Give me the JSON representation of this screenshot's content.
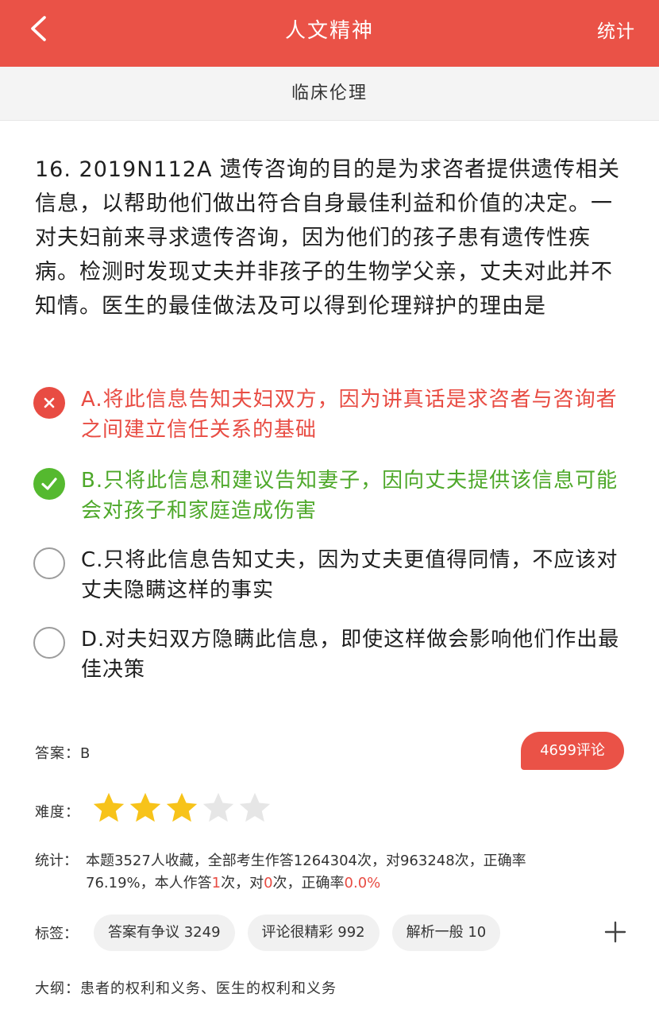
{
  "header": {
    "title": "人文精神",
    "right_link": "统计"
  },
  "subheader": {
    "category": "临床伦理"
  },
  "question": {
    "text": "16. 2019N112A 遗传咨询的目的是为求咨者提供遗传相关信息，以帮助他们做出符合自身最佳利益和价值的决定。一对夫妇前来寻求遗传咨询，因为他们的孩子患有遗传性疾病。检测时发现丈夫并非孩子的生物学父亲，丈夫对此并不知情。医生的最佳做法及可以得到伦理辩护的理由是"
  },
  "options": [
    {
      "text": "A.将此信息告知夫妇双方，因为讲真话是求咨者与咨询者之间建立信任关系的基础",
      "status": "wrong"
    },
    {
      "text": "B.只将此信息和建议告知妻子，因向丈夫提供该信息可能会对孩子和家庭造成伤害",
      "status": "correct"
    },
    {
      "text": "C.只将此信息告知丈夫，因为丈夫更值得同情，不应该对丈夫隐瞒这样的事实",
      "status": "unselected"
    },
    {
      "text": "D.对夫妇双方隐瞒此信息，即使这样做会影响他们作出最佳决策",
      "status": "unselected"
    }
  ],
  "answer": {
    "label": "答案：",
    "value": "B"
  },
  "comments": {
    "label": "4699评论"
  },
  "difficulty": {
    "label": "难度：",
    "stars_filled": 3,
    "stars_total": 5
  },
  "stats": {
    "label": "统计：",
    "line1": "本题3527人收藏，全部考生作答1264304次，对963248次，正确率",
    "line2_a": "76.19%，本人作答",
    "my_attempts": "1",
    "line2_b": "次，对",
    "my_correct": "0",
    "line2_c": "次，正确率",
    "my_rate": "0.0%"
  },
  "tags": {
    "label": "标签：",
    "items": [
      {
        "text": "答案有争议 3249"
      },
      {
        "text": "评论很精彩 992"
      },
      {
        "text": "解析一般 10"
      }
    ]
  },
  "outline": {
    "label": "大纲：",
    "value": "患者的权利和义务、医生的权利和义务"
  },
  "colors": {
    "brand": "#ea5247",
    "correct": "#55b92f",
    "star_filled": "#f7c31a",
    "star_empty": "#e6e6e6"
  },
  "icons": {
    "back": "chevron-left-icon",
    "wrong": "close-icon",
    "correct": "check-icon",
    "add": "plus-icon",
    "star": "star-icon"
  }
}
